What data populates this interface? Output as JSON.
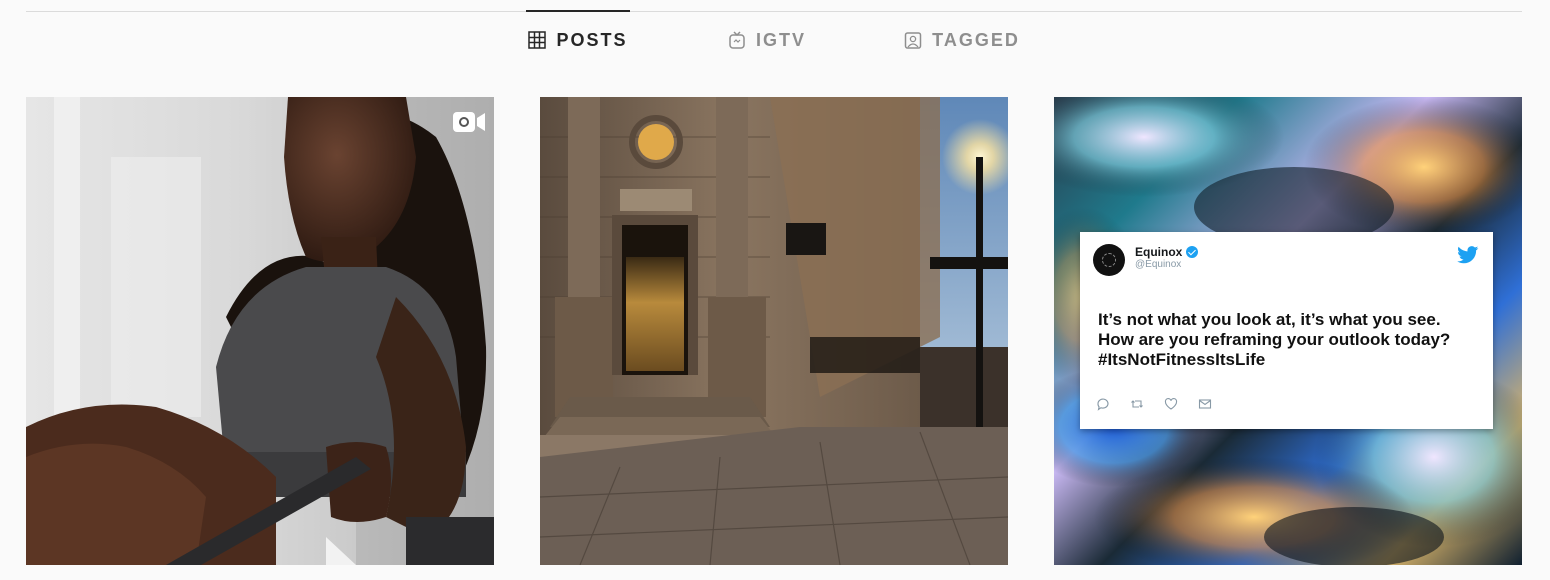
{
  "tabs": [
    {
      "label": "POSTS",
      "icon": "grid-icon",
      "active": true
    },
    {
      "label": "IGTV",
      "icon": "igtv-icon",
      "active": false
    },
    {
      "label": "TAGGED",
      "icon": "tagged-icon",
      "active": false
    }
  ],
  "posts": [
    {
      "type": "video",
      "badge_icon": "video-camera-icon"
    },
    {
      "type": "photo"
    },
    {
      "type": "photo",
      "tweet": {
        "name": "Equinox",
        "handle": "@Equinox",
        "text": "It’s not what you look at, it’s what you see. How are you reframing your outlook today? #ItsNotFitnessItsLife",
        "action_icons": [
          "reply-icon",
          "retweet-icon",
          "like-icon",
          "message-icon"
        ]
      }
    }
  ],
  "colors": {
    "active_tab": "#262626",
    "inactive_tab": "#8e8e8e",
    "divider": "#dbdbdb",
    "twitter_blue": "#1da1f2"
  }
}
